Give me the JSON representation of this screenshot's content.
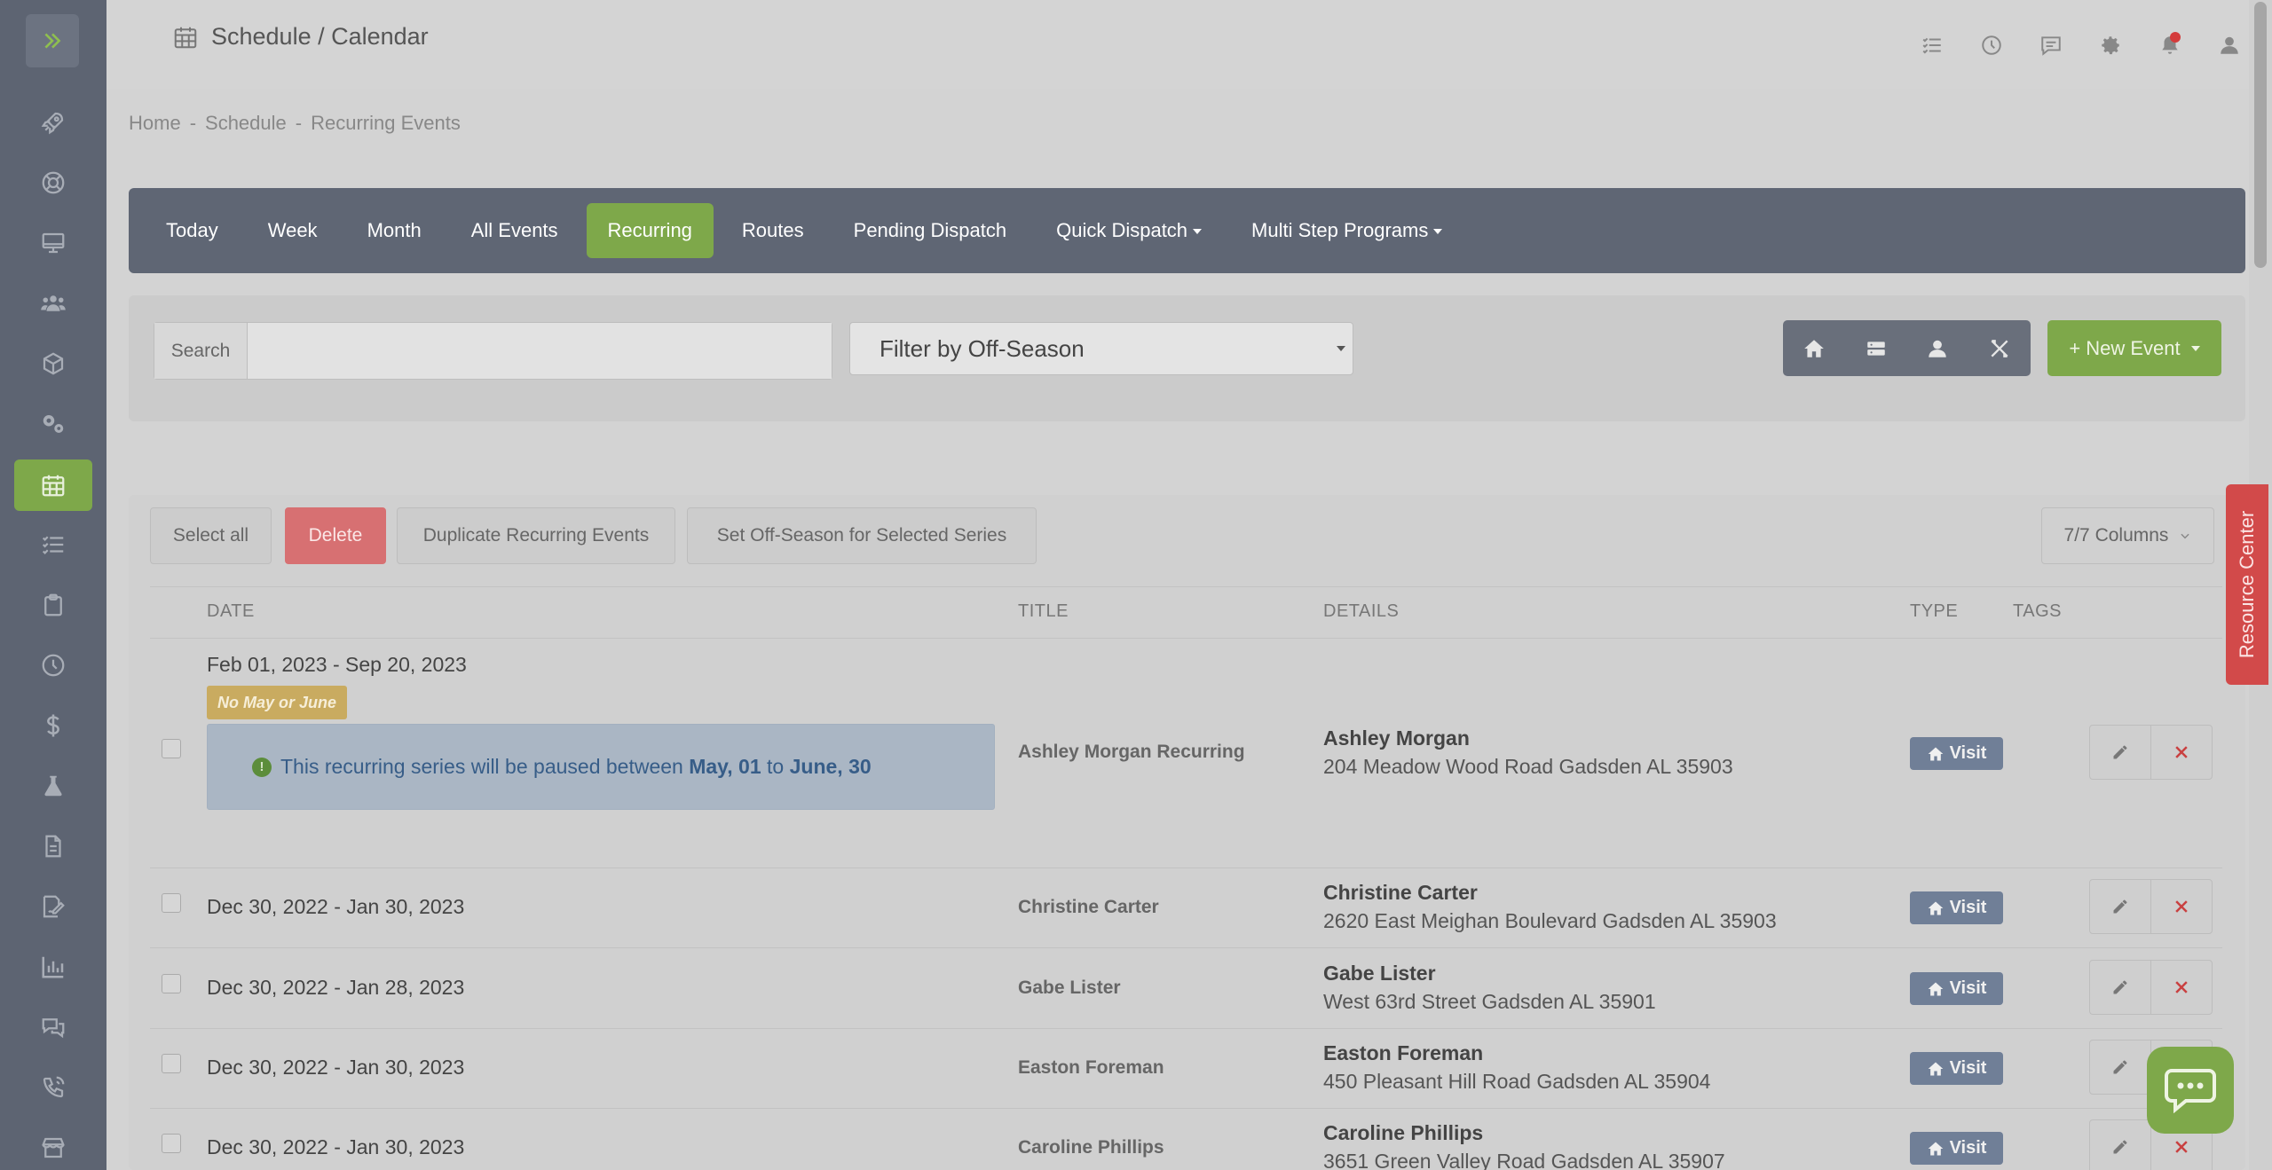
{
  "header": {
    "title": "Schedule / Calendar",
    "icons": [
      "checklist-icon",
      "clock-icon",
      "chat-icon",
      "gear-icon",
      "bell-icon",
      "user-icon"
    ]
  },
  "sidebar": {
    "items": [
      "rocket-icon",
      "lifebuoy-icon",
      "monitor-icon",
      "users-icon",
      "box-icon",
      "gears-icon",
      "calendar-icon",
      "list-icon",
      "clipboard-icon",
      "clock-icon",
      "dollar-icon",
      "flask-icon",
      "document-icon",
      "signature-icon",
      "chart-icon",
      "comments-icon",
      "phone-icon",
      "store-icon"
    ],
    "active": "calendar-icon"
  },
  "breadcrumb": [
    "Home",
    "Schedule",
    "Recurring Events"
  ],
  "breadcrumb_sep": "-",
  "nav": {
    "tabs": [
      "Today",
      "Week",
      "Month",
      "All Events",
      "Recurring",
      "Routes",
      "Pending Dispatch",
      "Quick Dispatch",
      "Multi Step Programs"
    ],
    "active": "Recurring"
  },
  "filters": {
    "search_label": "Search",
    "search_value": "",
    "offseason_select": "Filter by Off-Season",
    "new_event_label": "New Event"
  },
  "bulk": {
    "select_all": "Select all",
    "delete": "Delete",
    "duplicate": "Duplicate Recurring Events",
    "set_offseason": "Set Off-Season for Selected Series",
    "columns": "7/7 Columns"
  },
  "table": {
    "headers": [
      "DATE",
      "TITLE",
      "DETAILS",
      "TYPE",
      "TAGS"
    ],
    "rows": [
      {
        "date": "Feb 01, 2023 - Sep 20, 2023",
        "badge": "No May or June",
        "pause_prefix": "This recurring series will be paused between ",
        "pause_from": "May, 01",
        "pause_mid": " to ",
        "pause_to": "June, 30",
        "title": "Ashley Morgan Recurring",
        "name": "Ashley Morgan",
        "address": "204 Meadow Wood Road Gadsden AL 35903",
        "type": "Visit"
      },
      {
        "date": "Dec 30, 2022 - Jan 30, 2023",
        "title": "Christine Carter",
        "name": "Christine Carter",
        "address": "2620 East Meighan Boulevard Gadsden AL 35903",
        "type": "Visit"
      },
      {
        "date": "Dec 30, 2022 - Jan 28, 2023",
        "title": "Gabe Lister",
        "name": "Gabe Lister",
        "address": "West 63rd Street Gadsden AL 35901",
        "type": "Visit"
      },
      {
        "date": "Dec 30, 2022 - Jan 30, 2023",
        "title": "Easton Foreman",
        "name": "Easton Foreman",
        "address": "450 Pleasant Hill Road Gadsden AL 35904",
        "type": "Visit"
      },
      {
        "date": "Dec 30, 2022 - Jan 30, 2023",
        "title": "Caroline Phillips",
        "name": "Caroline Phillips",
        "address": "3651 Green Valley Road Gadsden AL 35907",
        "type": "Visit"
      }
    ]
  },
  "resource_center": "Resource Center",
  "colors": {
    "accent": "#7ea84a",
    "nav": "#5f6674",
    "danger": "#d77072",
    "badge": "#707f97"
  }
}
